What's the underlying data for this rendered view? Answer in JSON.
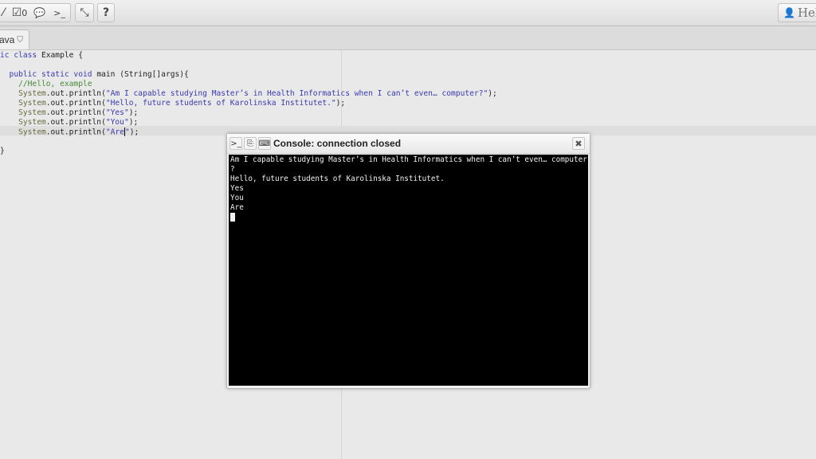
{
  "toolbar": {
    "buttons": [
      {
        "icon": "hammer-icon",
        "glyph": "⁄"
      },
      {
        "icon": "checklist-icon",
        "glyph": "☑",
        "count": "0"
      },
      {
        "icon": "chat-icon",
        "glyph": "💬"
      },
      {
        "icon": "terminal-icon",
        "glyph": ">_"
      }
    ],
    "shrink_glyph": "⤡",
    "help_label": "?",
    "user_glyph": "👤",
    "user_name": "Hele"
  },
  "tab": {
    "label": "ava",
    "shield_glyph": "⛉"
  },
  "editor": {
    "lines": [
      {
        "n": 1,
        "parts": [
          {
            "t": "ic ",
            "c": "kw"
          },
          {
            "t": "class ",
            "c": "kw"
          },
          {
            "t": "Example {",
            "c": ""
          }
        ]
      },
      {
        "n": 2,
        "parts": []
      },
      {
        "n": 3,
        "parts": [
          {
            "t": "  public ",
            "c": "kw"
          },
          {
            "t": "static ",
            "c": "kw"
          },
          {
            "t": "void ",
            "c": "kw"
          },
          {
            "t": "main (String[]args){",
            "c": ""
          }
        ]
      },
      {
        "n": 4,
        "parts": [
          {
            "t": "    //Hello, example",
            "c": "cm"
          }
        ]
      },
      {
        "n": 5,
        "parts": [
          {
            "t": "    System",
            "c": "mth"
          },
          {
            "t": ".out.println(",
            "c": ""
          },
          {
            "t": "\"Am I capable studying Master’s in Health Informatics when I can’t even… computer?\"",
            "c": "str"
          },
          {
            "t": ");",
            "c": ""
          }
        ]
      },
      {
        "n": 6,
        "parts": [
          {
            "t": "    System",
            "c": "mth"
          },
          {
            "t": ".out.println(",
            "c": ""
          },
          {
            "t": "\"Hello, future students of Karolinska Institutet.\"",
            "c": "str"
          },
          {
            "t": ");",
            "c": ""
          }
        ]
      },
      {
        "n": 7,
        "parts": [
          {
            "t": "    System",
            "c": "mth"
          },
          {
            "t": ".out.println(",
            "c": ""
          },
          {
            "t": "\"Yes\"",
            "c": "str"
          },
          {
            "t": ");",
            "c": ""
          }
        ]
      },
      {
        "n": 8,
        "parts": [
          {
            "t": "    System",
            "c": "mth"
          },
          {
            "t": ".out.println(",
            "c": ""
          },
          {
            "t": "\"You\"",
            "c": "str"
          },
          {
            "t": ");",
            "c": ""
          }
        ]
      },
      {
        "n": 9,
        "parts": [
          {
            "t": "    System",
            "c": "mth"
          },
          {
            "t": ".out.println(",
            "c": ""
          },
          {
            "t": "\"Are",
            "c": "str"
          },
          {
            "t": "|",
            "c": "caret"
          },
          {
            "t": "\"",
            "c": "str"
          },
          {
            "t": ");",
            "c": ""
          }
        ]
      },
      {
        "n": 10,
        "parts": []
      },
      {
        "n": 11,
        "parts": [
          {
            "t": "}",
            "c": ""
          }
        ]
      }
    ]
  },
  "console": {
    "title": "Console: connection closed",
    "close_label": "✖",
    "header_icons": [
      ">_",
      "⎘",
      "⌨"
    ],
    "output": [
      "Am I capable studying Master’s in Health Informatics when I can’t even… computer",
      "?",
      "Hello, future students of Karolinska Institutet.",
      "Yes",
      "You",
      "Are"
    ]
  }
}
